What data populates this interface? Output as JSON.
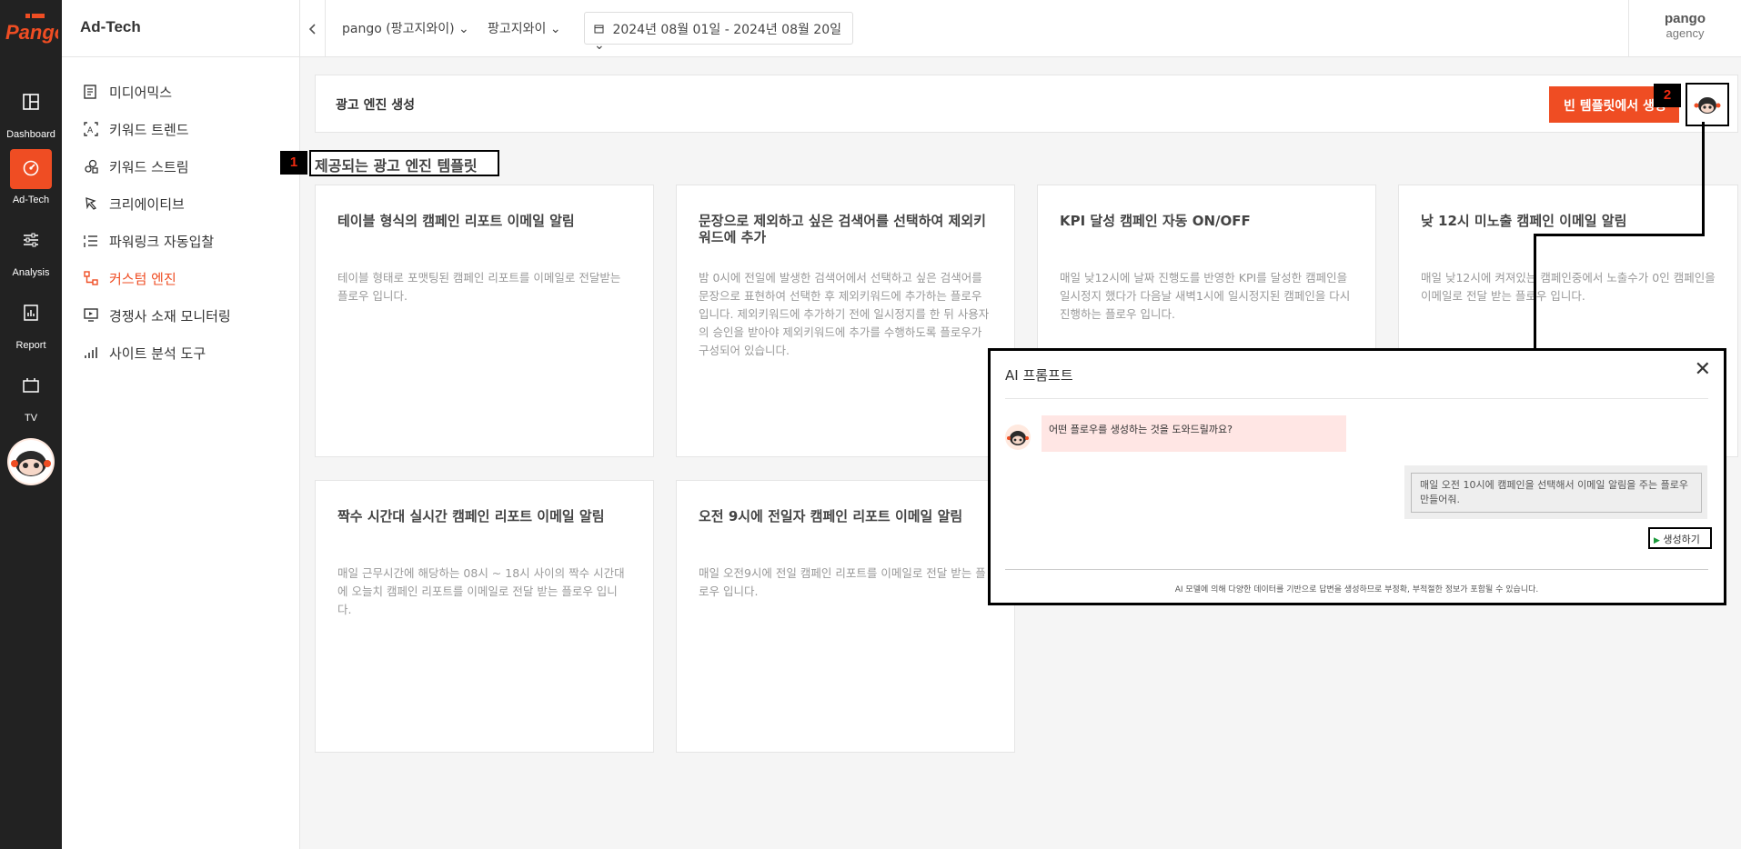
{
  "brand": {
    "logo_text": "Pango",
    "accent": "#ef4d23"
  },
  "rail": {
    "items": [
      {
        "label": "Dashboard",
        "icon": "layout-icon"
      },
      {
        "label": "Ad-Tech",
        "icon": "speed-gauge-icon",
        "active": true
      },
      {
        "label": "Analysis",
        "icon": "sliders-icon"
      },
      {
        "label": "Report",
        "icon": "report-icon"
      },
      {
        "label": "TV",
        "icon": "tv-icon"
      }
    ]
  },
  "sidebar": {
    "title": "Ad-Tech",
    "items": [
      {
        "label": "미디어믹스",
        "icon": "document-list-icon"
      },
      {
        "label": "키워드 트렌드",
        "icon": "keyword-trend-icon"
      },
      {
        "label": "키워드 스트림",
        "icon": "keyword-stream-icon"
      },
      {
        "label": "크리에이티브",
        "icon": "creative-icon"
      },
      {
        "label": "파워링크 자동입찰",
        "icon": "powerlink-list-icon"
      },
      {
        "label": "커스텀 엔진",
        "icon": "custom-engine-icon",
        "active": true
      },
      {
        "label": "경쟁사 소재 모니터링",
        "icon": "monitor-icon"
      },
      {
        "label": "사이트 분석 도구",
        "icon": "bar-chart-icon"
      }
    ]
  },
  "header": {
    "account": "pango (팡고지와이)",
    "advertiser": "팡고지와이",
    "date_range": "2024년 08월 01일 - 2024년 08월 20일",
    "user_name": "pango",
    "user_role": "agency"
  },
  "engine": {
    "title": "광고 엔진 생성",
    "blank_template_button": "빈 템플릿에서 생성",
    "badge_2": "2"
  },
  "templates": {
    "section_title": "제공되는 광고 엔진 템플릿",
    "badge_1": "1",
    "cards": [
      {
        "title": "테이블 형식의 캠페인 리포트 이메일 알림",
        "desc": "테이블 형태로 포맷팅된 캠페인 리포트를 이메일로 전달받는 플로우 입니다."
      },
      {
        "title": "문장으로 제외하고 싶은 검색어를 선택하여 제외키워드에 추가",
        "desc": "밤 0시에 전일에 발생한 검색어에서 선택하고 싶은 검색어를 문장으로 표현하여 선택한 후 제외키워드에 추가하는 플로우 입니다. 제외키워드에 추가하기 전에 일시정지를 한 뒤 사용자의 승인을 받아야 제외키워드에 추가를 수행하도록 플로우가 구성되어 있습니다."
      },
      {
        "title": "KPI 달성 캠페인 자동 ON/OFF",
        "desc": "매일 낮12시에 날짜 진행도를 반영한 KPI를 달성한 캠페인을 일시정지 했다가 다음날 새벽1시에 일시정지된 캠페인을 다시 진행하는 플로우 입니다."
      },
      {
        "title": "낮 12시 미노출 캠페인 이메일 알림",
        "desc": "매일 낮12시에 켜져있는 캠페인중에서 노출수가 0인 캠페인을 이메일로 전달 받는 플로우 입니다."
      },
      {
        "title": "짝수 시간대 실시간 캠페인 리포트 이메일 알림",
        "desc": "매일 근무시간에 해당하는 08시 ~ 18시 사이의 짝수 시간대에 오늘치 캠페인 리포트를 이메일로 전달 받는 플로우 입니다."
      },
      {
        "title": "오전 9시에 전일자 캠페인 리포트 이메일 알림",
        "desc": "매일 오전9시에 전일 캠페인 리포트를 이메일로 전달 받는 플로우 입니다."
      }
    ]
  },
  "ai_prompt": {
    "title": "AI 프롬프트",
    "close_symbol": "✕",
    "question": "어떤 플로우를 생성하는 것을 도와드릴까요?",
    "answer": "매일 오전 10시에 캠페인을 선택해서 이메일 알림을 주는 플로우 만들어줘.",
    "generate_button": "생성하기",
    "disclaimer": "AI 모델에 의해 다양한 데이터를 기반으로 답변을 생성하므로 부정확, 부적절한 정보가 포함될 수 있습니다."
  }
}
